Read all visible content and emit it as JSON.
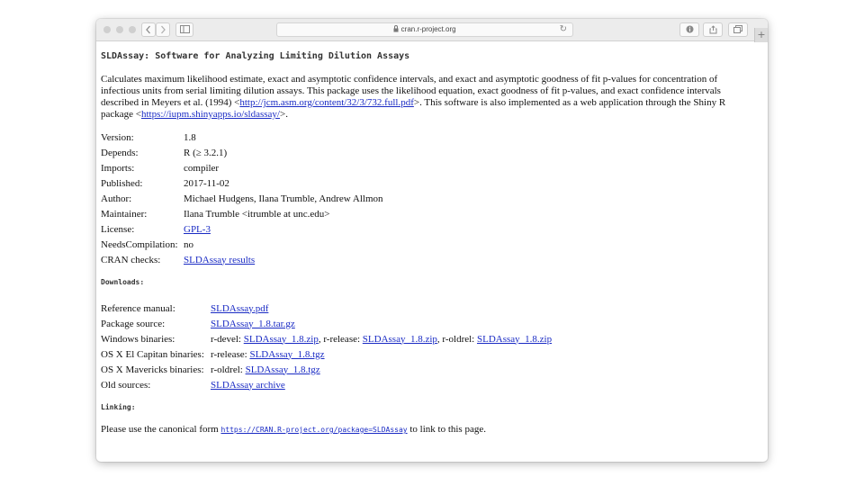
{
  "browser": {
    "url": "cran.r-project.org",
    "new_tab": "+",
    "reload_icon": "↻"
  },
  "page": {
    "title": "SLDAssay: Software for Analyzing Limiting Dilution Assays",
    "description": {
      "part1": "Calculates maximum likelihood estimate, exact and asymptotic confidence intervals, and exact and asymptotic goodness of fit p-values for concentration of infectious units from serial limiting dilution assays. This package uses the likelihood equation, exact goodness of fit p-values, and exact confidence intervals described in Meyers et al. (1994) <",
      "link1": "http://jcm.asm.org/content/32/3/732.full.pdf",
      "part2": ">. This software is also implemented as a web application through the Shiny R package <",
      "link2": "https://iupm.shinyapps.io/sldassay/",
      "part3": ">."
    },
    "meta": [
      {
        "key": "Version:",
        "value": "1.8",
        "link": false
      },
      {
        "key": "Depends:",
        "value": "R (≥ 3.2.1)",
        "link": false
      },
      {
        "key": "Imports:",
        "value": "compiler",
        "link": false
      },
      {
        "key": "Published:",
        "value": "2017-11-02",
        "link": false
      },
      {
        "key": "Author:",
        "value": "Michael Hudgens, Ilana Trumble, Andrew Allmon",
        "link": false
      },
      {
        "key": "Maintainer:",
        "value": "Ilana Trumble <itrumble at unc.edu>",
        "link": false
      },
      {
        "key": "License:",
        "value": "GPL-3",
        "link": true
      },
      {
        "key": "NeedsCompilation:",
        "value": "no",
        "link": false
      },
      {
        "key": "CRAN checks:",
        "value": "SLDAssay results",
        "link": true
      }
    ],
    "downloads_heading": "Downloads:",
    "downloads": {
      "reference_manual": {
        "key": "Reference manual:",
        "link": "SLDAssay.pdf"
      },
      "package_source": {
        "key": "Package source:",
        "link": "SLDAssay_1.8.tar.gz"
      },
      "windows": {
        "key": "Windows binaries:",
        "t1": "r-devel: ",
        "l1": "SLDAssay_1.8.zip",
        "t2": ", r-release: ",
        "l2": "SLDAssay_1.8.zip",
        "t3": ", r-oldrel: ",
        "l3": "SLDAssay_1.8.zip"
      },
      "osx_elcapitan": {
        "key": "OS X El Capitan binaries:",
        "t1": "r-release: ",
        "l1": "SLDAssay_1.8.tgz"
      },
      "osx_mavericks": {
        "key": "OS X Mavericks binaries:",
        "t1": "r-oldrel: ",
        "l1": "SLDAssay_1.8.tgz"
      },
      "old_sources": {
        "key": "Old sources:",
        "link": "SLDAssay archive"
      }
    },
    "linking_heading": "Linking:",
    "linking": {
      "before": "Please use the canonical form ",
      "url": "https://CRAN.R-project.org/package=SLDAssay",
      "after": " to link to this page."
    }
  }
}
